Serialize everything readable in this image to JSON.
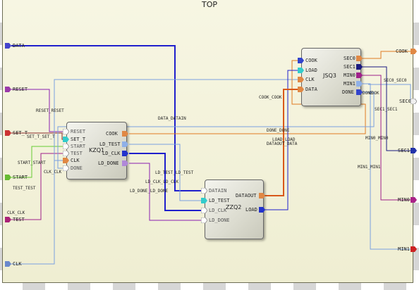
{
  "title": "TOP",
  "colors": {
    "blue": "#1f1fcc",
    "lightblue": "#7aa0e0",
    "purple": "#8a1fb0",
    "green": "#66cc33",
    "orange": "#e07a20",
    "brown": "#8a4a2a",
    "magenta": "#a0208a",
    "red": "#cc2020",
    "teal": "#20a0a0",
    "navy": "#1a1a80"
  },
  "top_inputs": [
    {
      "label": "DATA",
      "color": "#4444cc"
    },
    {
      "label": "RESET",
      "color": "#9a3aaa"
    },
    {
      "label": "SET_T",
      "color": "#cc3333"
    },
    {
      "label": "START",
      "color": "#66bb33"
    },
    {
      "label": "TEST",
      "color": "#aa2277"
    },
    {
      "label": "CLK",
      "color": "#6a88cc"
    }
  ],
  "top_outputs": [
    {
      "label": "COOK",
      "color": "#e08844"
    },
    {
      "label": "SEC0",
      "color": "#f0f0f0"
    },
    {
      "label": "SEC1",
      "color": "#2233aa"
    },
    {
      "label": "MIN0",
      "color": "#aa2288"
    },
    {
      "label": "MIN1",
      "color": "#cc2222"
    }
  ],
  "blocks": {
    "kzq1": {
      "name": "KZQ1",
      "inputs": [
        "RESET",
        "SET_T",
        "START",
        "TEST",
        "CLK",
        "DONE"
      ],
      "outputs": [
        "COOK",
        "LD_TEST",
        "LD_CLK",
        "LD_DONE"
      ]
    },
    "jsq3": {
      "name": "JSQ3",
      "inputs": [
        "COOK",
        "LOAD",
        "CLK",
        "DATA"
      ],
      "outputs": [
        "SEC0",
        "SEC1",
        "MIN0",
        "MIN1",
        "DONE"
      ]
    },
    "zzq2": {
      "name": "ZZQ2",
      "inputs": [
        "DATAIN",
        "LD_TEST",
        "LD_CLK",
        "LD_DONE"
      ],
      "outputs": [
        "DATAOUT",
        "LOAD"
      ]
    }
  },
  "wire_labels": {
    "reset": "RESET_RESET",
    "set_t": "SET_T_SET_T",
    "start": "START_START",
    "test": "TEST_TEST",
    "clk1": "CLK_CLK",
    "clk2": "CLK_CLK",
    "data": "DATA_DATAIN",
    "cook": "COOK_COOK",
    "done": "DONE_DONE",
    "load": "LOAD_LOAD",
    "dataout": "DATAOUT_DATA",
    "ld_test": "LD_TEST_LD_TEST",
    "ld_clk": "LD_CLK_LD_CLK",
    "ld_done": "LD_DONE_LD_DONE",
    "sec0": "SEC0_SEC0",
    "sec1": "SEC1_SEC1",
    "min0": "MIN0_MIN0",
    "min1": "MIN1_MIN1",
    "done_out": "DONE",
    "cook_out": "COOK"
  }
}
